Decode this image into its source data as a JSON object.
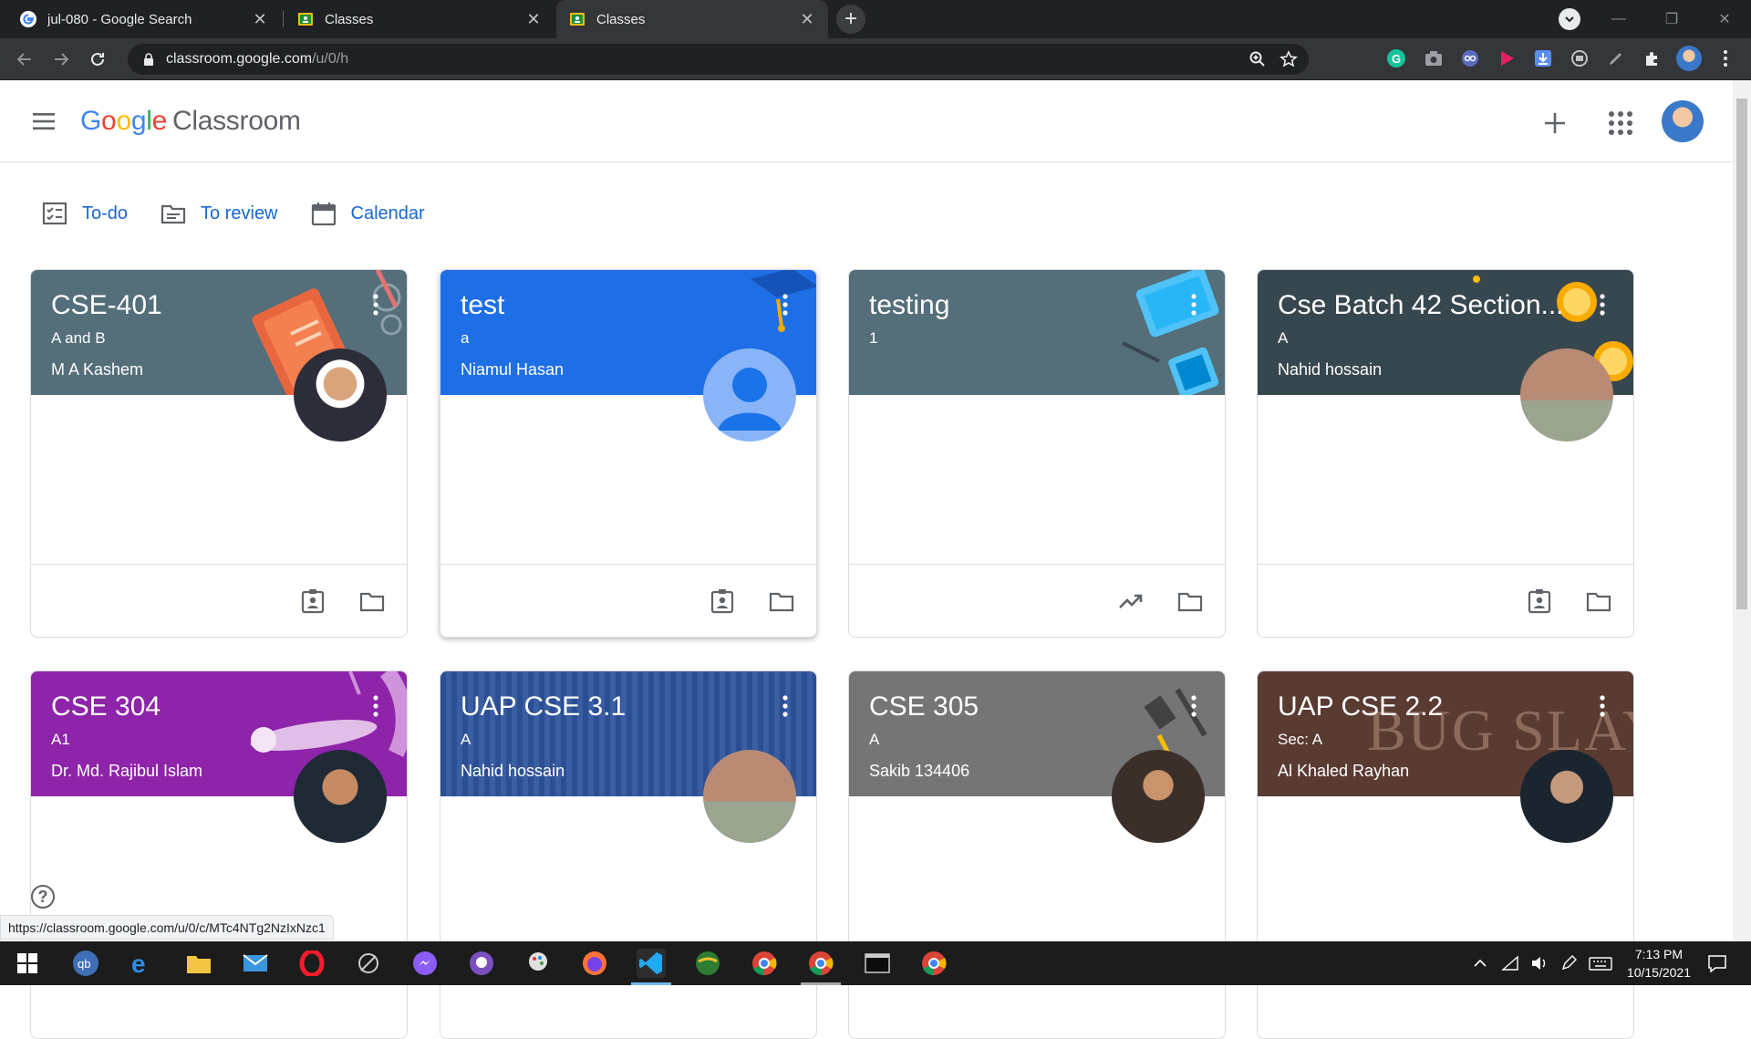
{
  "browser": {
    "tabs": [
      {
        "title": "jul-080 - Google Search",
        "icon": "google-g-icon",
        "active": false
      },
      {
        "title": "Classes",
        "icon": "classroom-icon",
        "active": false
      },
      {
        "title": "Classes",
        "icon": "classroom-icon",
        "active": true
      }
    ],
    "url_host": "classroom.google.com",
    "url_path": "/u/0/h"
  },
  "header": {
    "logo_google": [
      "G",
      "o",
      "o",
      "g",
      "l",
      "e"
    ],
    "logo_product": "Classroom"
  },
  "nav": {
    "todo": "To-do",
    "review": "To review",
    "calendar": "Calendar"
  },
  "classes": [
    {
      "name": "CSE-401",
      "section": "A and B",
      "teacher": "M A Kashem",
      "color": "#546e7a",
      "icons": [
        "assignment-ind-icon",
        "folder-icon"
      ]
    },
    {
      "name": "test",
      "section": "a",
      "teacher": "Niamul Hasan",
      "color": "#1e6ee6",
      "icons": [
        "assignment-ind-icon",
        "folder-icon"
      ]
    },
    {
      "name": "testing",
      "section": "1",
      "teacher": "",
      "color": "#546e7a",
      "icons": [
        "trending-up-icon",
        "folder-icon"
      ]
    },
    {
      "name": "Cse Batch 42 Section...",
      "section": "A",
      "teacher": "Nahid hossain",
      "color": "#37474f",
      "icons": [
        "assignment-ind-icon",
        "folder-icon"
      ]
    },
    {
      "name": "CSE 304",
      "section": "A1",
      "teacher": "Dr. Md. Rajibul Islam",
      "color": "#8e24aa",
      "icons": []
    },
    {
      "name": "UAP CSE 3.1",
      "section": "A",
      "teacher": "Nahid hossain",
      "color": "#2c4f94",
      "icons": []
    },
    {
      "name": "CSE 305",
      "section": "A",
      "teacher": "Sakib 134406",
      "color": "#757575",
      "icons": []
    },
    {
      "name": "UAP CSE 2.2",
      "section": "Sec: A",
      "teacher": "Al Khaled Rayhan",
      "color": "#5a3b32",
      "banner_text": "BUG SLAYER",
      "icons": []
    }
  ],
  "status_url": "https://classroom.google.com/u/0/c/MTc4NTg2NzIxNzc1",
  "taskbar": {
    "time": "7:13 PM",
    "date": "10/15/2021"
  }
}
